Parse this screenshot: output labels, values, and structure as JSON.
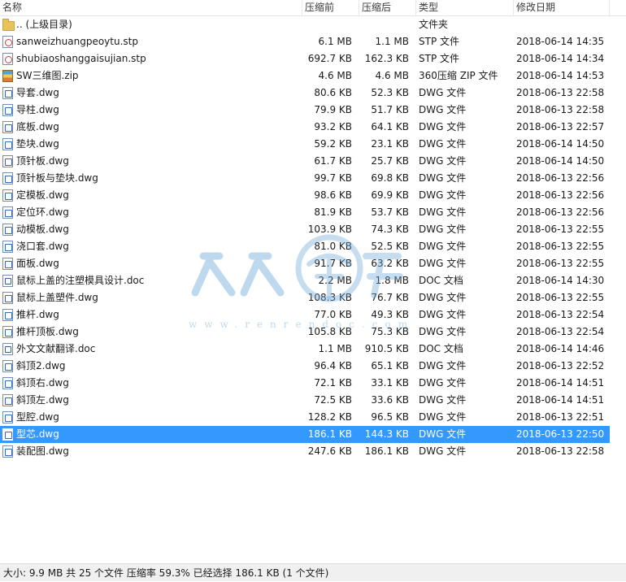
{
  "columns": {
    "name": "名称",
    "size": "压缩前",
    "packed": "压缩后",
    "type": "类型",
    "modified": "修改日期"
  },
  "files": [
    {
      "name": ".. (上级目录)",
      "size": "",
      "packed": "",
      "type": "文件夹",
      "modified": "",
      "icon": "folder-icon"
    },
    {
      "name": "sanweizhuangpeoytu.stp",
      "size": "6.1 MB",
      "packed": "1.1 MB",
      "type": "STP 文件",
      "modified": "2018-06-14 14:35",
      "icon": "stp-file-icon"
    },
    {
      "name": "shubiaoshanggaisujian.stp",
      "size": "692.7 KB",
      "packed": "162.3 KB",
      "type": "STP 文件",
      "modified": "2018-06-14 14:34",
      "icon": "stp-file-icon"
    },
    {
      "name": "SW三维图.zip",
      "size": "4.6 MB",
      "packed": "4.6 MB",
      "type": "360压缩 ZIP 文件",
      "modified": "2018-06-14 14:53",
      "icon": "zip-file-icon"
    },
    {
      "name": "导套.dwg",
      "size": "80.6 KB",
      "packed": "52.3 KB",
      "type": "DWG 文件",
      "modified": "2018-06-13 22:58",
      "icon": "dwg-file-icon"
    },
    {
      "name": "导柱.dwg",
      "size": "79.9 KB",
      "packed": "51.7 KB",
      "type": "DWG 文件",
      "modified": "2018-06-13 22:58",
      "icon": "dwg-file-icon"
    },
    {
      "name": "底板.dwg",
      "size": "93.2 KB",
      "packed": "64.1 KB",
      "type": "DWG 文件",
      "modified": "2018-06-13 22:57",
      "icon": "dwg-file-icon"
    },
    {
      "name": "垫块.dwg",
      "size": "59.2 KB",
      "packed": "23.1 KB",
      "type": "DWG 文件",
      "modified": "2018-06-14 14:50",
      "icon": "dwg-file-icon"
    },
    {
      "name": "顶针板.dwg",
      "size": "61.7 KB",
      "packed": "25.7 KB",
      "type": "DWG 文件",
      "modified": "2018-06-14 14:50",
      "icon": "dwg-file-icon"
    },
    {
      "name": "顶针板与垫块.dwg",
      "size": "99.7 KB",
      "packed": "69.8 KB",
      "type": "DWG 文件",
      "modified": "2018-06-13 22:56",
      "icon": "dwg-file-icon"
    },
    {
      "name": "定模板.dwg",
      "size": "98.6 KB",
      "packed": "69.9 KB",
      "type": "DWG 文件",
      "modified": "2018-06-13 22:56",
      "icon": "dwg-file-icon"
    },
    {
      "name": "定位环.dwg",
      "size": "81.9 KB",
      "packed": "53.7 KB",
      "type": "DWG 文件",
      "modified": "2018-06-13 22:56",
      "icon": "dwg-file-icon"
    },
    {
      "name": "动模板.dwg",
      "size": "103.9 KB",
      "packed": "74.3 KB",
      "type": "DWG 文件",
      "modified": "2018-06-13 22:55",
      "icon": "dwg-file-icon"
    },
    {
      "name": "浇口套.dwg",
      "size": "81.0 KB",
      "packed": "52.5 KB",
      "type": "DWG 文件",
      "modified": "2018-06-13 22:55",
      "icon": "dwg-file-icon"
    },
    {
      "name": "面板.dwg",
      "size": "91.7 KB",
      "packed": "63.2 KB",
      "type": "DWG 文件",
      "modified": "2018-06-13 22:55",
      "icon": "dwg-file-icon"
    },
    {
      "name": "鼠标上盖的注塑模具设计.doc",
      "size": "2.2 MB",
      "packed": "1.8 MB",
      "type": "DOC 文档",
      "modified": "2018-06-14 14:30",
      "icon": "doc-file-icon"
    },
    {
      "name": "鼠标上盖塑件.dwg",
      "size": "108.3 KB",
      "packed": "76.7 KB",
      "type": "DWG 文件",
      "modified": "2018-06-13 22:55",
      "icon": "dwg-file-icon"
    },
    {
      "name": "推杆.dwg",
      "size": "77.0 KB",
      "packed": "49.3 KB",
      "type": "DWG 文件",
      "modified": "2018-06-13 22:54",
      "icon": "dwg-file-icon"
    },
    {
      "name": "推杆顶板.dwg",
      "size": "105.8 KB",
      "packed": "75.3 KB",
      "type": "DWG 文件",
      "modified": "2018-06-13 22:54",
      "icon": "dwg-file-icon"
    },
    {
      "name": "外文文献翻译.doc",
      "size": "1.1 MB",
      "packed": "910.5 KB",
      "type": "DOC 文档",
      "modified": "2018-06-14 14:46",
      "icon": "doc-file-icon"
    },
    {
      "name": "斜顶2.dwg",
      "size": "96.4 KB",
      "packed": "65.1 KB",
      "type": "DWG 文件",
      "modified": "2018-06-13 22:52",
      "icon": "dwg-file-icon"
    },
    {
      "name": "斜顶右.dwg",
      "size": "72.1 KB",
      "packed": "33.1 KB",
      "type": "DWG 文件",
      "modified": "2018-06-14 14:51",
      "icon": "dwg-file-icon"
    },
    {
      "name": "斜顶左.dwg",
      "size": "72.5 KB",
      "packed": "33.6 KB",
      "type": "DWG 文件",
      "modified": "2018-06-14 14:51",
      "icon": "dwg-file-icon"
    },
    {
      "name": "型腔.dwg",
      "size": "128.2 KB",
      "packed": "96.5 KB",
      "type": "DWG 文件",
      "modified": "2018-06-13 22:51",
      "icon": "dwg-file-icon"
    },
    {
      "name": "型芯.dwg",
      "size": "186.1 KB",
      "packed": "144.3 KB",
      "type": "DWG 文件",
      "modified": "2018-06-13 22:50",
      "icon": "dwg-file-icon",
      "selected": true
    },
    {
      "name": "装配图.dwg",
      "size": "247.6 KB",
      "packed": "186.1 KB",
      "type": "DWG 文件",
      "modified": "2018-06-13 22:58",
      "icon": "dwg-file-icon"
    }
  ],
  "watermark": {
    "text": "www.renrendoc.com"
  },
  "status": {
    "text": "大小: 9.9 MB 共 25 个文件 压缩率 59.3% 已经选择 186.1 KB (1 个文件)"
  },
  "colors": {
    "selection": "#3399ff",
    "status_bg": "#f0f0f0"
  }
}
